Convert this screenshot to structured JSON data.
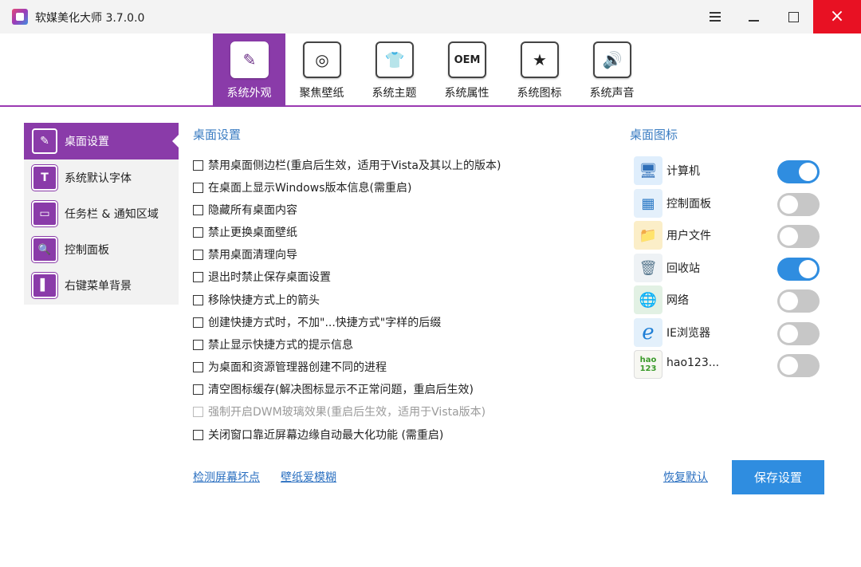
{
  "window": {
    "title": "软媒美化大师 3.7.0.0",
    "controls": {
      "menu": "menu-icon",
      "minimize": "minimize-icon",
      "maximize": "maximize-icon",
      "close": "×"
    }
  },
  "colors": {
    "accent": "#8a3ba9",
    "blue": "#2f8de0",
    "link": "#2a6fc0",
    "close_red": "#e81123"
  },
  "top_nav": [
    {
      "label": "系统外观",
      "icon": "brush-icon",
      "glyph": "✎",
      "active": true
    },
    {
      "label": "聚焦壁纸",
      "icon": "wallpaper-focus-icon",
      "glyph": "◎",
      "active": false
    },
    {
      "label": "系统主题",
      "icon": "tshirt-icon",
      "glyph": "👕",
      "active": false
    },
    {
      "label": "系统属性",
      "icon": "oem-icon",
      "glyph": "OEM",
      "active": false
    },
    {
      "label": "系统图标",
      "icon": "star-icon",
      "glyph": "★",
      "active": false
    },
    {
      "label": "系统声音",
      "icon": "speaker-icon",
      "glyph": "🔊",
      "active": false
    }
  ],
  "sidebar": [
    {
      "label": "桌面设置",
      "icon": "brush-icon",
      "glyph": "✎",
      "active": true
    },
    {
      "label": "系统默认字体",
      "icon": "font-icon",
      "glyph": "T",
      "active": false
    },
    {
      "label": "任务栏 & 通知区域",
      "icon": "taskbar-icon",
      "glyph": "▭",
      "active": false
    },
    {
      "label": "控制面板",
      "icon": "magnifier-icon",
      "glyph": "🔍",
      "active": false
    },
    {
      "label": "右键菜单背景",
      "icon": "context-menu-icon",
      "glyph": "▌",
      "active": false
    }
  ],
  "main": {
    "section_title": "桌面设置",
    "options": [
      {
        "label": "禁用桌面侧边栏(重启后生效，适用于Vista及其以上的版本)",
        "checked": false,
        "disabled": false
      },
      {
        "label": "在桌面上显示Windows版本信息(需重启)",
        "checked": false,
        "disabled": false
      },
      {
        "label": "隐藏所有桌面内容",
        "checked": false,
        "disabled": false
      },
      {
        "label": "禁止更换桌面壁纸",
        "checked": false,
        "disabled": false
      },
      {
        "label": "禁用桌面清理向导",
        "checked": false,
        "disabled": false
      },
      {
        "label": "退出时禁止保存桌面设置",
        "checked": false,
        "disabled": false
      },
      {
        "label": "移除快捷方式上的箭头",
        "checked": false,
        "disabled": false
      },
      {
        "label": "创建快捷方式时，不加\"...快捷方式\"字样的后缀",
        "checked": false,
        "disabled": false
      },
      {
        "label": "禁止显示快捷方式的提示信息",
        "checked": false,
        "disabled": false
      },
      {
        "label": "为桌面和资源管理器创建不同的进程",
        "checked": false,
        "disabled": false
      },
      {
        "label": "清空图标缓存(解决图标显示不正常问题，重启后生效)",
        "checked": false,
        "disabled": false
      },
      {
        "label": "强制开启DWM玻璃效果(重启后生效，适用于Vista版本)",
        "checked": false,
        "disabled": true
      },
      {
        "label": "关闭窗口靠近屏幕边缘自动最大化功能 (需重启)",
        "checked": false,
        "disabled": false
      }
    ],
    "links": {
      "check_pixels": "检测屏幕坏点",
      "wallpaper": "壁纸爱模糊",
      "restore_default": "恢复默认"
    },
    "save_button": "保存设置"
  },
  "desktop_icons": {
    "title": "桌面图标",
    "items": [
      {
        "label": "计算机",
        "icon": "computer-icon",
        "glyph": "🖥",
        "on": true
      },
      {
        "label": "控制面板",
        "icon": "control-panel-icon",
        "glyph": "▦",
        "on": false
      },
      {
        "label": "用户文件",
        "icon": "user-folder-icon",
        "glyph": "📁",
        "on": false
      },
      {
        "label": "回收站",
        "icon": "recycle-bin-icon",
        "glyph": "🗑",
        "on": true
      },
      {
        "label": "网络",
        "icon": "network-icon",
        "glyph": "🌐",
        "on": false
      },
      {
        "label": "IE浏览器",
        "icon": "ie-browser-icon",
        "glyph": "e",
        "on": false
      },
      {
        "label": "hao123...",
        "icon": "hao123-icon",
        "glyph": "hao 123",
        "on": false
      }
    ]
  }
}
